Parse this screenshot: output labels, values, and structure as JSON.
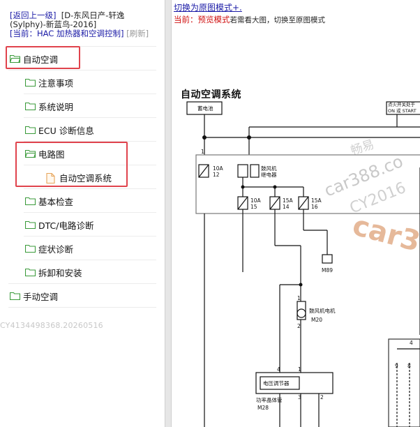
{
  "breadcrumb": {
    "back_link": "[返回上一级]",
    "vehicle": "[D-东风日产-轩逸(Sylphy)-新蓝鸟-2016]",
    "current": "[当前：HAC 加热器和空调控制]",
    "refresh": "[刷新]"
  },
  "tree": {
    "auto_ac": "自动空调",
    "items": [
      "注意事项",
      "系统说明",
      "ECU 诊断信息",
      "电路图",
      "基本检查",
      "DTC/电路诊断",
      "症状诊断",
      "拆卸和安装"
    ],
    "wiring_child": "自动空调系统",
    "manual_ac": "手动空调"
  },
  "watermark_left": "CY4134498368.20260516",
  "right": {
    "switch_link": "切换为原图模式+.",
    "hint_current": "当前：",
    "hint_mode": "预览模式",
    "hint_rest": "若需看大图，切换至原图模式",
    "diagram_title": "自动空调系统"
  },
  "diagram": {
    "battery": "蓄电池",
    "ignition": "点火开关处于",
    "ignition2": "ON 或 START",
    "fuse1": "10A",
    "fuse1_no": "12",
    "relay_label1": "鼓风机",
    "relay_label2": "继电器",
    "fuse2": "10A",
    "fuse2_no": "15",
    "fuse3": "15A",
    "fuse3_no": "14",
    "fuse4": "15A",
    "fuse4_no": "16",
    "m89": "M89",
    "motor_label": "鼓风机电机",
    "m20": "M20",
    "regulator": "电压调节器",
    "transistor": "功率晶体管",
    "m28": "M28",
    "pin1": "1",
    "pin2": "2",
    "pin3": "3",
    "pin4": "4",
    "pin9": "9",
    "pin8": "8"
  },
  "overlay_watermarks": [
    "畅易",
    "car388.co",
    "CY2016",
    "car3"
  ],
  "colors": {
    "highlight_box": "#e0434c",
    "folder_green": "#3a9a3a",
    "link_blue": "#1a1aa6",
    "red_text": "#d01010"
  }
}
